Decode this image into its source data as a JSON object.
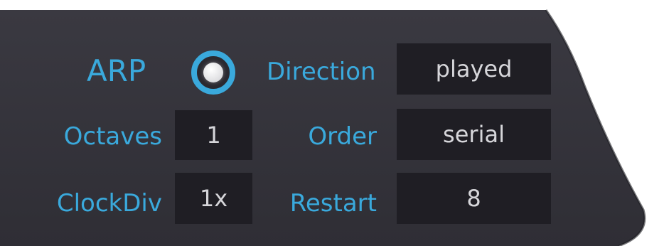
{
  "arp": {
    "label": "ARP",
    "toggle_on": true
  },
  "params": {
    "octaves": {
      "label": "Octaves",
      "value": "1"
    },
    "clockdiv": {
      "label": "ClockDiv",
      "value": "1x"
    },
    "direction": {
      "label": "Direction",
      "value": "played"
    },
    "order": {
      "label": "Order",
      "value": "serial"
    },
    "restart": {
      "label": "Restart",
      "value": "8"
    }
  },
  "colors": {
    "panel": "#35343c",
    "accent": "#3aa9dc",
    "field_bg": "#1f1e24",
    "field_text": "#d6d6da"
  }
}
